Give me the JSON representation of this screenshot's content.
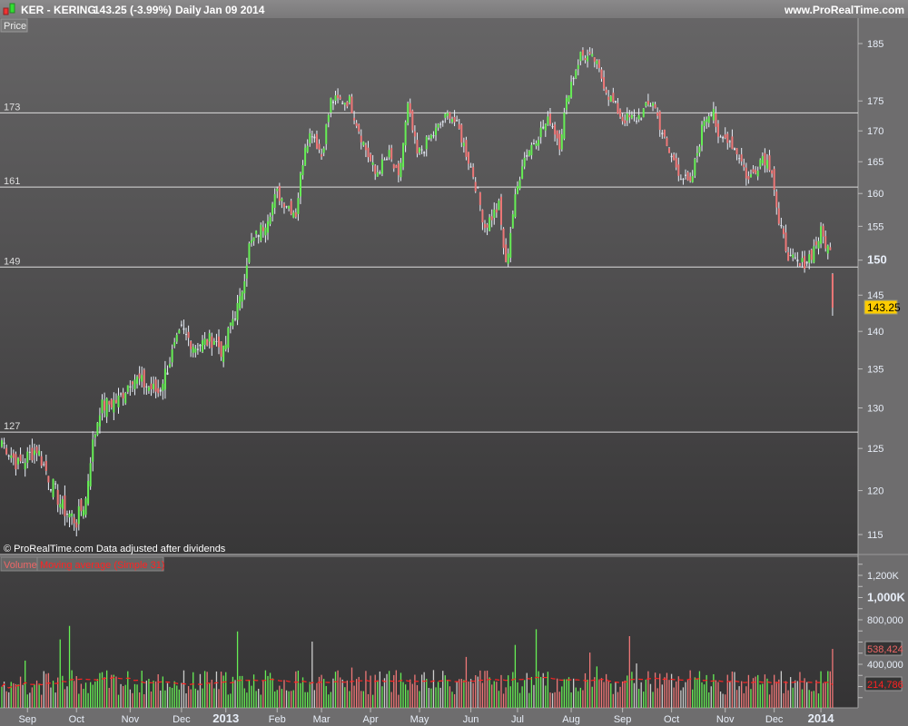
{
  "header": {
    "symbol": "KER - KERING",
    "price": "143.25 (-3.99%)",
    "period": "Daily",
    "date": "Jan 09 2014",
    "site": "www.ProRealTime.com"
  },
  "price_panel": {
    "tab": "Price",
    "copyright": "© ProRealTime.com  Data adjusted after dividends",
    "last_price": "143.25",
    "levels": [
      {
        "label": "173",
        "value": 173
      },
      {
        "label": "161",
        "value": 161
      },
      {
        "label": "149",
        "value": 149
      },
      {
        "label": "127",
        "value": 127
      }
    ],
    "axis_ticks": [
      {
        "label": "185",
        "value": 185
      },
      {
        "label": "175",
        "value": 175
      },
      {
        "label": "170",
        "value": 170
      },
      {
        "label": "165",
        "value": 165
      },
      {
        "label": "160",
        "value": 160
      },
      {
        "label": "155",
        "value": 155
      },
      {
        "label": "150",
        "value": 150
      },
      {
        "label": "145",
        "value": 145
      },
      {
        "label": "140",
        "value": 140
      },
      {
        "label": "135",
        "value": 135
      },
      {
        "label": "130",
        "value": 130
      },
      {
        "label": "125",
        "value": 125
      },
      {
        "label": "120",
        "value": 120
      },
      {
        "label": "115",
        "value": 115
      }
    ]
  },
  "volume_panel": {
    "tab_volume": "Volume",
    "tab_ma": "Moving average (Simple 31)",
    "last_volume": "538,424",
    "last_ma": "214,786",
    "axis_ticks": [
      {
        "label": "1,200K",
        "value": 1200000
      },
      {
        "label": "1,000K",
        "value": 1000000
      },
      {
        "label": "800,000",
        "value": 800000
      },
      {
        "label": "400,000",
        "value": 400000
      }
    ]
  },
  "x_axis": [
    {
      "label": "Sep",
      "bar": 11
    },
    {
      "label": "Oct",
      "bar": 32
    },
    {
      "label": "Nov",
      "bar": 55
    },
    {
      "label": "Dec",
      "bar": 77
    },
    {
      "label": "2013",
      "bar": 96
    },
    {
      "label": "Feb",
      "bar": 118
    },
    {
      "label": "Mar",
      "bar": 137
    },
    {
      "label": "Apr",
      "bar": 158
    },
    {
      "label": "May",
      "bar": 179
    },
    {
      "label": "Jun",
      "bar": 201
    },
    {
      "label": "Jul",
      "bar": 221
    },
    {
      "label": "Aug",
      "bar": 244
    },
    {
      "label": "Sep",
      "bar": 266
    },
    {
      "label": "Oct",
      "bar": 287
    },
    {
      "label": "Nov",
      "bar": 310
    },
    {
      "label": "Dec",
      "bar": 331
    },
    {
      "label": "2014",
      "bar": 351
    }
  ],
  "colors": {
    "up": "#66ee55",
    "down": "#ee7777",
    "neutral": "#dde4ee",
    "ma": "#ff2222",
    "last": "#ffcc00"
  },
  "chart_data": {
    "type": "candlestick",
    "total_bars": 357,
    "scale": "log",
    "ylim": [
      115,
      185
    ],
    "close_keyframes": [
      [
        0,
        126
      ],
      [
        7,
        123
      ],
      [
        15,
        125
      ],
      [
        21,
        121
      ],
      [
        26,
        118
      ],
      [
        32,
        116.5
      ],
      [
        36,
        119
      ],
      [
        38,
        124
      ],
      [
        42,
        130
      ],
      [
        50,
        131
      ],
      [
        56,
        134
      ],
      [
        61,
        133
      ],
      [
        67,
        132
      ],
      [
        73,
        137
      ],
      [
        77,
        140
      ],
      [
        83,
        138
      ],
      [
        91,
        139
      ],
      [
        95,
        137
      ],
      [
        98,
        141
      ],
      [
        102,
        144
      ],
      [
        106,
        152
      ],
      [
        112,
        155
      ],
      [
        118,
        160
      ],
      [
        126,
        157
      ],
      [
        130,
        168
      ],
      [
        133,
        170
      ],
      [
        137,
        166
      ],
      [
        141,
        175
      ],
      [
        149,
        175
      ],
      [
        155,
        168
      ],
      [
        160,
        163
      ],
      [
        166,
        166
      ],
      [
        170,
        162
      ],
      [
        174,
        174
      ],
      [
        178,
        166
      ],
      [
        186,
        170
      ],
      [
        192,
        173
      ],
      [
        196,
        170
      ],
      [
        202,
        163
      ],
      [
        207,
        155
      ],
      [
        213,
        158
      ],
      [
        216,
        149
      ],
      [
        219,
        157
      ],
      [
        223,
        165
      ],
      [
        229,
        169
      ],
      [
        235,
        172
      ],
      [
        239,
        168
      ],
      [
        243,
        177
      ],
      [
        248,
        183
      ],
      [
        254,
        182
      ],
      [
        260,
        176
      ],
      [
        266,
        172
      ],
      [
        272,
        172
      ],
      [
        279,
        175
      ],
      [
        285,
        167
      ],
      [
        291,
        163
      ],
      [
        295,
        161
      ],
      [
        301,
        172
      ],
      [
        305,
        174
      ],
      [
        307,
        168
      ],
      [
        311,
        169
      ],
      [
        316,
        166
      ],
      [
        320,
        162
      ],
      [
        326,
        166
      ],
      [
        330,
        164
      ],
      [
        333,
        155
      ],
      [
        338,
        150
      ],
      [
        342,
        149
      ],
      [
        347,
        151
      ],
      [
        351,
        154
      ],
      [
        355,
        151
      ],
      [
        356,
        143.25
      ]
    ],
    "volume_ylim": [
      0,
      1300000
    ],
    "volume_typical": 250000,
    "volume_last": 538424,
    "ma_last": 214786
  }
}
